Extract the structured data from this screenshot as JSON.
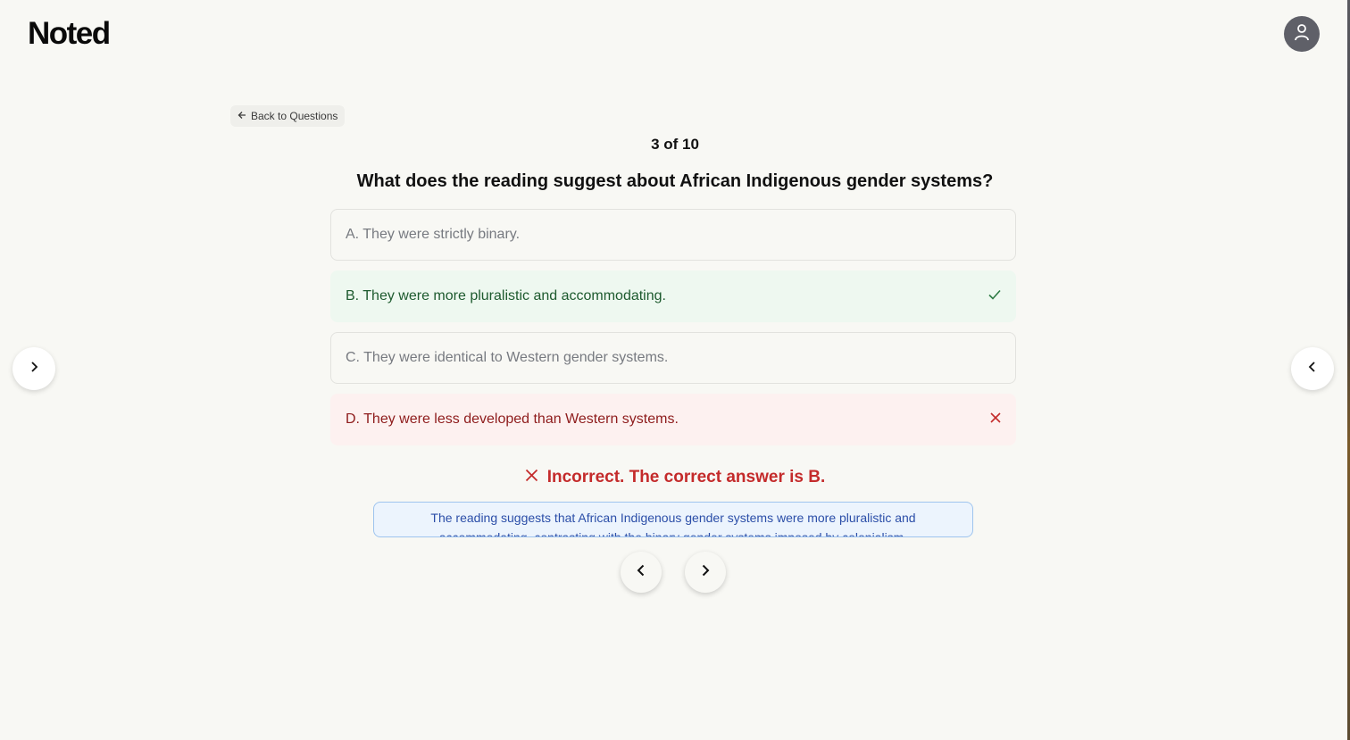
{
  "app": {
    "logo": "Noted"
  },
  "header": {
    "avatar_icon": "user-icon"
  },
  "nav": {
    "back_label": "Back to Questions"
  },
  "quiz": {
    "counter": "3 of 10",
    "question": "What does the reading suggest about African Indigenous gender systems?",
    "options": [
      {
        "label": "A. They were strictly binary.",
        "state": "neutral"
      },
      {
        "label": "B. They were more pluralistic and accommodating.",
        "state": "correct"
      },
      {
        "label": "C. They were identical to Western gender systems.",
        "state": "neutral"
      },
      {
        "label": "D. They were less developed than Western systems.",
        "state": "incorrect"
      }
    ],
    "result": "Incorrect. The correct answer is B.",
    "explanation": "The reading suggests that African Indigenous gender systems were more pluralistic and accommodating, contrasting with the binary gender systems imposed by colonialism."
  },
  "colors": {
    "correct": "#1d5a2e",
    "incorrect": "#8e1c1c",
    "result": "#c42b2b",
    "explanation": "#2b4ea8"
  }
}
